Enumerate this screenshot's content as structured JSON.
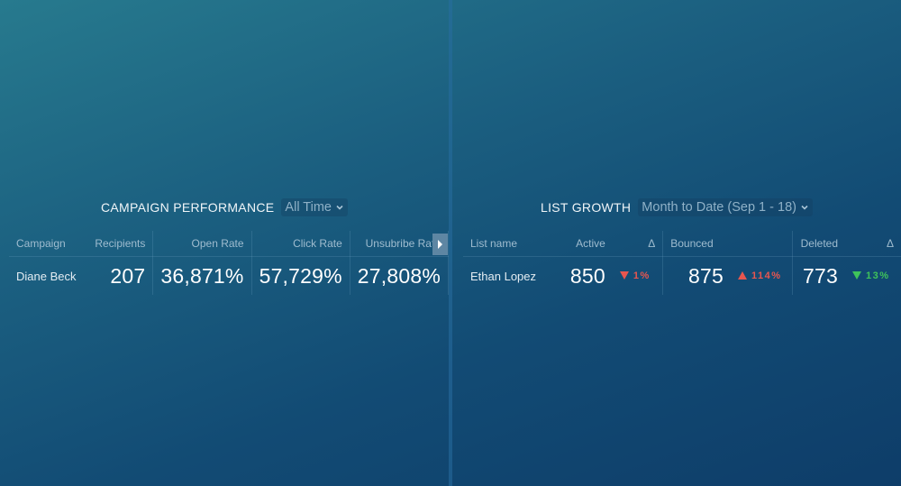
{
  "campaign_performance": {
    "title": "CAMPAIGN PERFORMANCE",
    "range": "All Time",
    "columns": [
      "Campaign",
      "Recipients",
      "Open Rate",
      "Click Rate",
      "Unsubribe Rate"
    ],
    "rows": [
      {
        "campaign": "Diane Beck",
        "recipients": "207",
        "open_rate": "36,871%",
        "click_rate": "57,729%",
        "unsubscribe_rate": "27,808%"
      }
    ],
    "scroll_icon": "caret-right-icon"
  },
  "list_growth": {
    "title": "LIST GROWTH",
    "range": "Month to Date (Sep 1 - 18)",
    "columns": [
      "List name",
      "Active",
      "Δ",
      "Bounced",
      "Deleted",
      "Δ"
    ],
    "rows": [
      {
        "list_name": "Ethan Lopez",
        "active": "850",
        "active_delta": {
          "direction": "down",
          "value": "1%",
          "color": "#e8564f"
        },
        "bounced": "875",
        "bounced_delta": {
          "direction": "up",
          "value": "114%",
          "color": "#e8564f"
        },
        "deleted": "773",
        "deleted_delta": {
          "direction": "down",
          "value": "13%",
          "color": "#3fc35a"
        }
      }
    ]
  },
  "colors": {
    "bg_top_left": "#277a8e",
    "bg_bottom_right": "#0e3d69",
    "negative": "#e8564f",
    "positive": "#3fc35a"
  }
}
